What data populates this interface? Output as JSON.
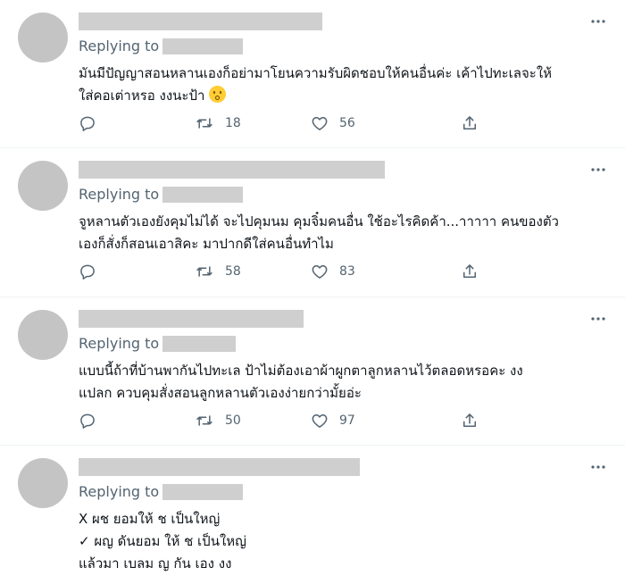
{
  "tweets": [
    {
      "replying_label": "Replying to",
      "lines": [
        "มันมีปัญญาสอนหลานเองก็อย่ามาโยนความรับผิดชอบให้คนอื่นค่ะ เค้าไปทะเลจะให้",
        "ใส่คอเต่าหรอ งงนะป้า"
      ],
      "emoji": "shushing-face-emoji",
      "replies": "",
      "retweets": "18",
      "likes": "56"
    },
    {
      "replying_label": "Replying to",
      "lines": [
        "จูหลานตัวเองยังคุมไม่ได้ จะไปคุมนม คุมจิ๋มคนอื่น ใช้อะไรคิดค้า...าาาาา คนของตัว",
        "เองก็สั่งก็สอนเอาสิคะ มาปากดีใส่คนอื่นทำไม"
      ],
      "replies": "",
      "retweets": "58",
      "likes": "83"
    },
    {
      "replying_label": "Replying to",
      "lines": [
        "แบบนี้ถ้าที่บ้านพากันไปทะเล ป้าไม่ต้องเอาผ้าผูกตาลูกหลานไว้ตลอดหรอคะ งง",
        "แปลก ควบคุมสั่งสอนลูกหลานตัวเองง่ายกว่ามั้ยอ่ะ"
      ],
      "replies": "",
      "retweets": "50",
      "likes": "97"
    },
    {
      "replying_label": "Replying to",
      "lines": [
        "X ผช ยอมให้ ช เป็นใหญ่",
        "✓ ผญ ดันยอม ให้ ช เป็นใหญ่",
        "แล้วมา เบลม ญ กัน เอง งง"
      ]
    }
  ],
  "colors": {
    "text": "#0f1419",
    "muted": "#536471",
    "redacted": "#cfcfcf",
    "avatar": "#c4c4c4"
  }
}
